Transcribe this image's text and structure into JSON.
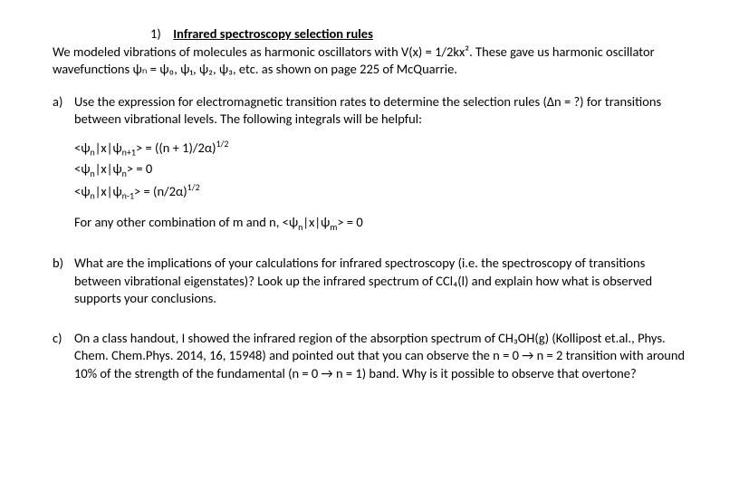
{
  "title_num": "1)",
  "title": "Infrared spectroscopy selection rules",
  "intro": "We modeled vibrations of molecules as harmonic oscillators with V(x) = 1/2kx². These gave us harmonic oscillator wavefunctions ψₙ = ψ₀, ψ₁, ψ₂, ψ₃,  etc. as shown on page 225 of McQuarrie.",
  "a": {
    "letter": "a)",
    "p1": "Use the expression for electromagnetic transition rates to determine the selection rules (Δn = ?) for transitions between vibrational levels. The following integrals will be helpful:",
    "eq1_a": "<ψ",
    "eq1_sub1": "n",
    "eq1_b": "|x|ψ",
    "eq1_sub2": "n+1",
    "eq1_c": "> = ((n + 1)/2α)",
    "eq1_sup": "1/2",
    "eq2_a": "<ψ",
    "eq2_sub1": "n",
    "eq2_b": "|x|ψ",
    "eq2_sub2": "n",
    "eq2_c": "> =  0",
    "eq3_a": "<ψ",
    "eq3_sub1": "n",
    "eq3_b": "|x|ψ",
    "eq3_sub2": "n-1",
    "eq3_c": "> = (n/2α)",
    "eq3_sup": "1/2",
    "p2_a": "For any other combination of m and n,   <ψ",
    "p2_sub1": "n",
    "p2_b": "|x|ψ",
    "p2_sub2": "m",
    "p2_c": "> =  0"
  },
  "b": {
    "letter": "b)",
    "p1": "What are the implications of your calculations for infrared spectroscopy (i.e. the spectroscopy of transitions between vibrational eigenstates)? Look up the infrared spectrum of CCl₄(l) and explain how what is observed supports your conclusions."
  },
  "c": {
    "letter": "c)",
    "p1": "On a class handout, I showed the infrared region of the absorption spectrum of CH₃OH(g) (Kollipost et.al., Phys. Chem. Chem.Phys. 2014, 16, 15948) and pointed out that you can observe the n = 0 → n = 2 transition with around 10% of the strength of the fundamental (n = 0 → n = 1) band. Why is it possible to observe that overtone?"
  }
}
